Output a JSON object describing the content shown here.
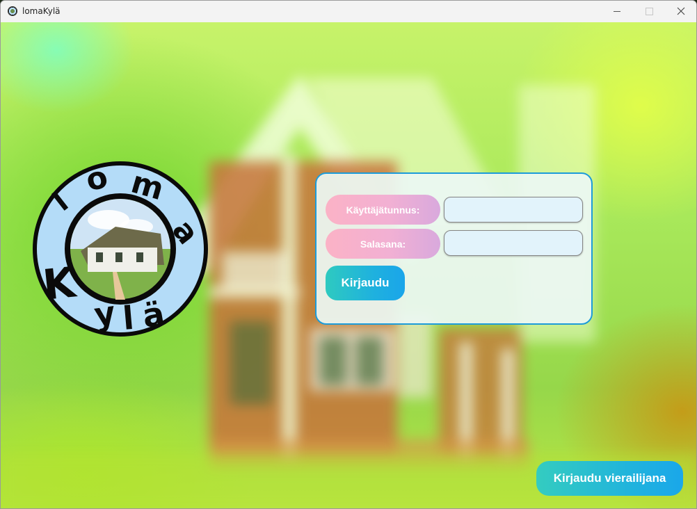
{
  "window": {
    "title": "lomaKylä",
    "icon": "globe-app-icon"
  },
  "controls": {
    "minimize_icon": "minimize-icon",
    "maximize_icon": "maximize-icon",
    "close_icon": "close-icon"
  },
  "logo": {
    "line1": "loma",
    "line2": "Kylä",
    "ring_color": "#b4dcf8",
    "outline_color": "#0a0a0a"
  },
  "login": {
    "username_label": "Käyttäjätunnus:",
    "password_label": "Salasana:",
    "username_value": "",
    "password_value": "",
    "submit_label": "Kirjaudu",
    "border_color": "#1c9bd9"
  },
  "guest": {
    "label": "Kirjaudu vierailijana"
  },
  "colors": {
    "pill_pink": "#fbb2c6",
    "button_teal": "#2ecac0",
    "button_blue": "#1aa5ea",
    "field_bg": "#e2f3fb"
  }
}
